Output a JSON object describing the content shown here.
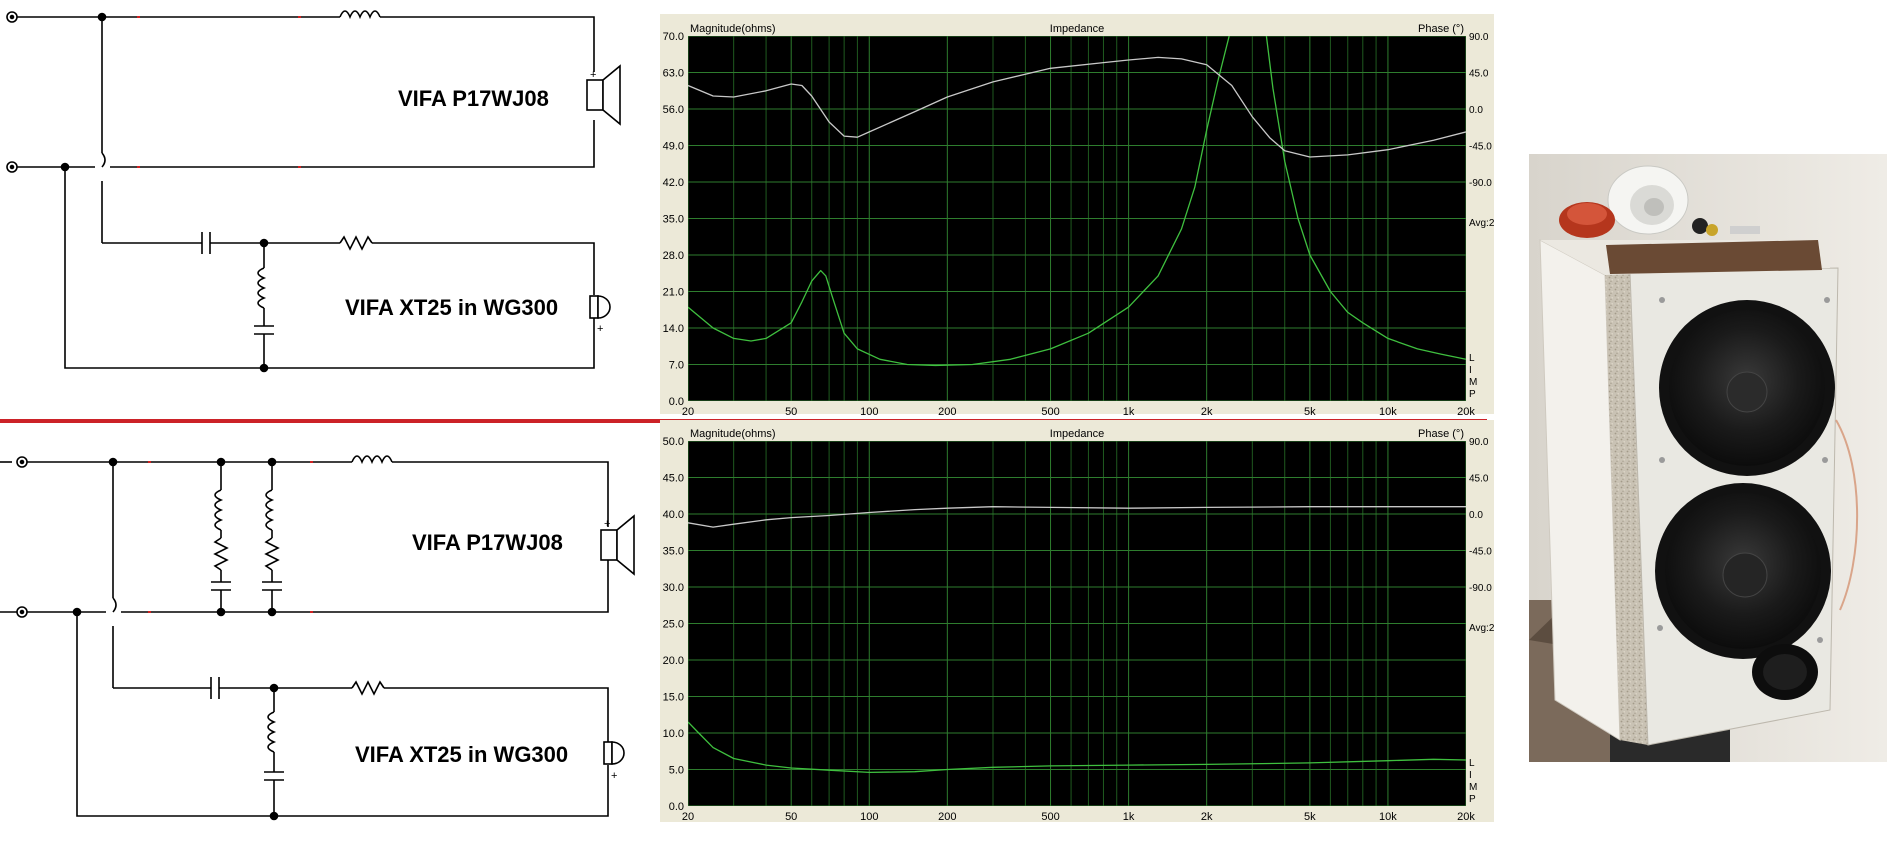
{
  "circuits": {
    "top": {
      "woofer_label": "VIFA P17WJ08",
      "tweeter_label": "VIFA XT25 in WG300",
      "plus_sign": "+"
    },
    "bottom": {
      "woofer_label": "VIFA P17WJ08",
      "tweeter_label": "VIFA XT25 in WG300",
      "plus_sign": "+"
    }
  },
  "chart_data": [
    {
      "type": "line",
      "title": "Impedance",
      "ylabel_left": "Magnitude(ohms)",
      "ylabel_right": "Phase (°)",
      "x_scale": "log",
      "xlim": [
        20,
        20000
      ],
      "ylim": [
        0,
        70
      ],
      "y_ticks": [
        "70.0",
        "63.0",
        "56.0",
        "49.0",
        "42.0",
        "35.0",
        "28.0",
        "21.0",
        "14.0",
        "7.0",
        "0.0"
      ],
      "x_ticks": [
        20,
        50,
        100,
        200,
        500,
        1000,
        2000,
        5000,
        10000,
        20000
      ],
      "x_tick_labels": [
        "20",
        "50",
        "100",
        "200",
        "500",
        "1k",
        "2k",
        "5k",
        "10k",
        "20k"
      ],
      "phase_ticks": [
        "90.0",
        "45.0",
        "0.0",
        "-45.0",
        "-90.0"
      ],
      "right_extra": "Avg:2",
      "lmp": [
        "L",
        "I",
        "M",
        "P"
      ],
      "grid": true,
      "series": [
        {
          "color": "#3fbf3f",
          "x": [
            20,
            25,
            30,
            35,
            40,
            50,
            55,
            60,
            65,
            68,
            72,
            80,
            90,
            110,
            140,
            180,
            250,
            350,
            500,
            700,
            1000,
            1300,
            1600,
            1800,
            2000,
            2200,
            2500,
            2800,
            3000,
            3200,
            3400,
            3600,
            4000,
            4500,
            5000,
            6000,
            7000,
            8000,
            10000,
            13000,
            16000,
            20000
          ],
          "y": [
            18,
            14,
            12,
            11.5,
            12,
            15,
            19,
            23,
            25,
            24,
            20,
            13,
            10,
            8,
            7,
            6.8,
            7,
            8,
            10,
            13,
            18,
            24,
            33,
            41,
            52,
            61,
            72,
            80,
            80,
            78,
            70,
            60,
            46,
            35,
            28,
            21,
            17,
            15,
            12,
            10,
            9,
            8
          ]
        },
        {
          "color": "#c8c8c8",
          "x": [
            20,
            25,
            30,
            40,
            50,
            55,
            60,
            70,
            80,
            90,
            100,
            150,
            200,
            300,
            500,
            800,
            1000,
            1300,
            1600,
            2000,
            2500,
            3000,
            3500,
            4000,
            5000,
            7000,
            10000,
            15000,
            20000
          ],
          "y": [
            60.5,
            58.5,
            58.3,
            59.5,
            60.8,
            60.5,
            58.5,
            53.5,
            50.8,
            50.6,
            51.6,
            55.5,
            58.3,
            61.2,
            63.8,
            64.9,
            65.4,
            65.9,
            65.6,
            64.5,
            60.5,
            54.5,
            50.5,
            48,
            46.8,
            47.2,
            48.2,
            50,
            51.6
          ]
        }
      ]
    },
    {
      "type": "line",
      "title": "Impedance",
      "ylabel_left": "Magnitude(ohms)",
      "ylabel_right": "Phase (°)",
      "x_scale": "log",
      "xlim": [
        20,
        20000
      ],
      "ylim": [
        0,
        50
      ],
      "y_ticks": [
        "50.0",
        "45.0",
        "40.0",
        "35.0",
        "30.0",
        "25.0",
        "20.0",
        "15.0",
        "10.0",
        "5.0",
        "0.0"
      ],
      "x_ticks": [
        20,
        50,
        100,
        200,
        500,
        1000,
        2000,
        5000,
        10000,
        20000
      ],
      "x_tick_labels": [
        "20",
        "50",
        "100",
        "200",
        "500",
        "1k",
        "2k",
        "5k",
        "10k",
        "20k"
      ],
      "phase_ticks": [
        "90.0",
        "45.0",
        "0.0",
        "-45.0",
        "-90.0"
      ],
      "right_extra": "Avg:2",
      "lmp": [
        "L",
        "I",
        "M",
        "P"
      ],
      "grid": true,
      "series": [
        {
          "color": "#3fbf3f",
          "x": [
            20,
            22,
            25,
            30,
            40,
            50,
            70,
            100,
            150,
            200,
            300,
            500,
            1000,
            2000,
            5000,
            10000,
            15000,
            20000
          ],
          "y": [
            11.5,
            10,
            8,
            6.5,
            5.6,
            5.2,
            4.9,
            4.6,
            4.7,
            5,
            5.3,
            5.5,
            5.6,
            5.7,
            5.9,
            6.2,
            6.4,
            6.3
          ]
        },
        {
          "color": "#c8c8c8",
          "x": [
            20,
            25,
            30,
            40,
            50,
            70,
            100,
            150,
            200,
            300,
            500,
            1000,
            2000,
            5000,
            10000,
            20000
          ],
          "y": [
            38.8,
            38.2,
            38.6,
            39.2,
            39.5,
            39.8,
            40.2,
            40.6,
            40.8,
            41,
            40.9,
            40.8,
            40.9,
            41,
            41,
            41
          ]
        }
      ]
    }
  ]
}
